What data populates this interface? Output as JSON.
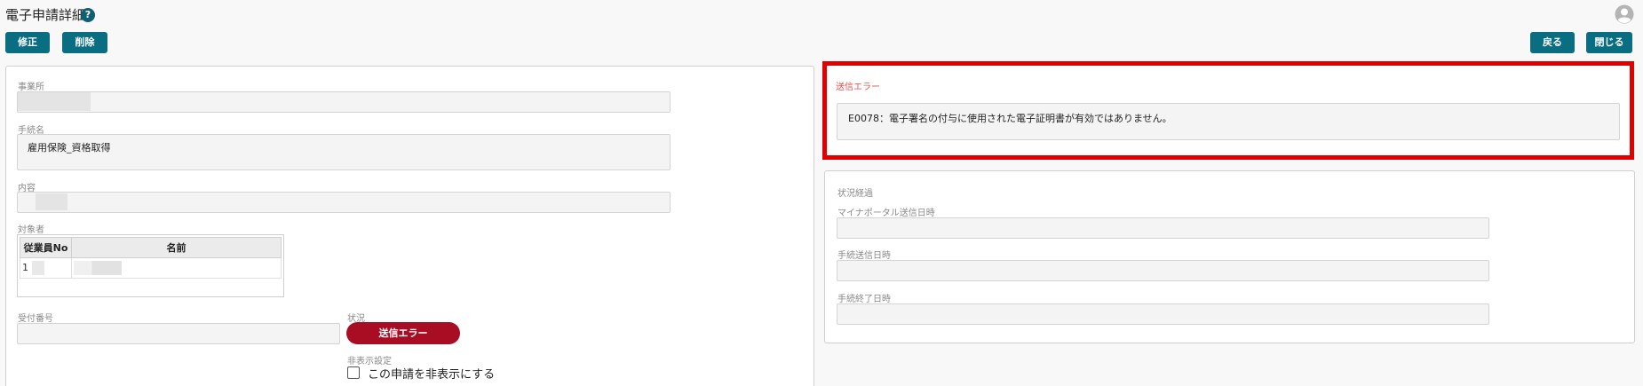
{
  "header": {
    "title": "電子申請詳細",
    "help_label": "?"
  },
  "toolbar": {
    "edit_label": "修正",
    "delete_label": "削除",
    "back_label": "戻る",
    "close_label": "閉じる"
  },
  "detail": {
    "office_label": "事業所",
    "procedure_label": "手続名",
    "procedure_value": "雇用保険_資格取得",
    "content_label": "内容",
    "target_label": "対象者",
    "table_headers": [
      "従業員No",
      "名前"
    ],
    "table_rows": [
      {
        "no": "1",
        "name": ""
      }
    ],
    "receipt_label": "受付番号",
    "status_label": "状況",
    "status_value": "送信エラー",
    "hide_setting_label": "非表示設定",
    "hide_checkbox_label": "この申請を非表示にする"
  },
  "error": {
    "title": "送信エラー",
    "message": "E0078：電子署名の付与に使用された電子証明書が有効ではありません。"
  },
  "progress": {
    "title": "状況経過",
    "mynaportal_label": "マイナポータル送信日時",
    "sent_label": "手続送信日時",
    "finished_label": "手続終了日時"
  },
  "colors": {
    "accent": "#0a6e82",
    "error_border": "#e10000",
    "status_badge": "#a80d24"
  }
}
